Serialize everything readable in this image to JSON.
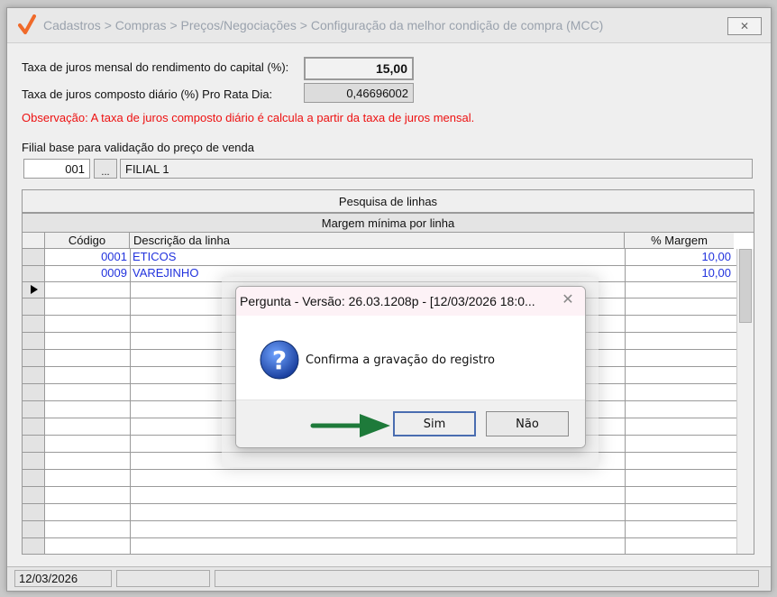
{
  "window": {
    "title": "Cadastros > Compras > Preços/Negociações > Configuração da melhor condição de compra (MCC)",
    "close_glyph": "✕"
  },
  "form": {
    "rate_monthly_label": "Taxa de juros mensal do rendimento do capital (%):",
    "rate_monthly_value": "15,00",
    "rate_daily_label": "Taxa de juros composto diário (%) Pro Rata Dia:",
    "rate_daily_value": "0,46696002",
    "note": "Observação: A taxa de juros composto diário é calcula a partir da taxa de juros mensal.",
    "branch_label": "Filial base para validação do preço de venda",
    "branch_code": "001",
    "branch_browse": "...",
    "branch_name": "FILIAL 1"
  },
  "grid": {
    "band_title": "Pesquisa de linhas",
    "band_subtitle": "Margem mínima por linha",
    "columns": [
      "Código",
      "Descrição da linha",
      "% Margem"
    ],
    "rows": [
      {
        "code": "0001",
        "description": "ETICOS",
        "margin": "10,00"
      },
      {
        "code": "0009",
        "description": "VAREJINHO",
        "margin": "10,00"
      }
    ]
  },
  "status": {
    "date": "12/03/2026"
  },
  "dialog": {
    "title": "Pergunta - Versão: 26.03.1208p - [12/03/2026 18:0...",
    "message": "Confirma a gravação do registro",
    "yes_label": "Sim",
    "no_label": "Não",
    "close_glyph": "✕"
  },
  "colors": {
    "accent_red": "#ee1111",
    "grid_text_blue": "#2233dd",
    "arrow_green": "#1e7a3a"
  }
}
